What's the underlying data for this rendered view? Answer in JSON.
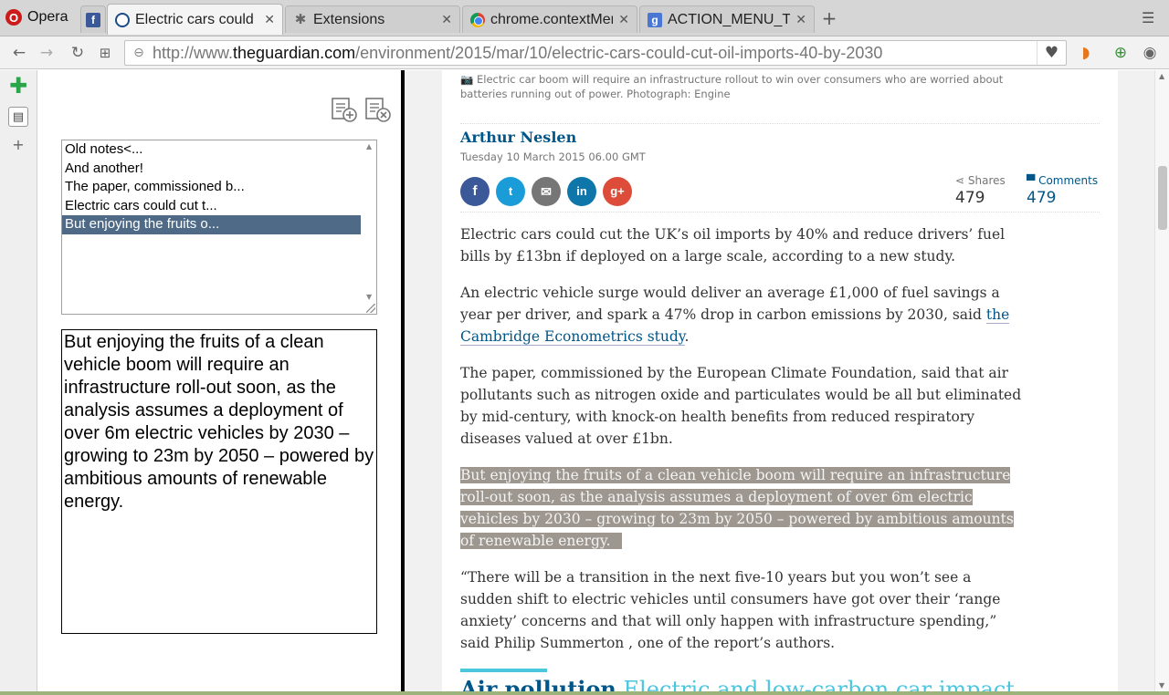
{
  "browser": {
    "opera_label": "Opera",
    "tabs": [
      {
        "title": "",
        "icon": "facebook-icon"
      },
      {
        "title": "Electric cars could c",
        "icon": "guardian-icon",
        "active": true
      },
      {
        "title": "Extensions",
        "icon": "puzzle-icon"
      },
      {
        "title": "chrome.contextMen",
        "icon": "chrome-icon"
      },
      {
        "title": "ACTION_MENU_T",
        "icon": "google-icon"
      }
    ],
    "url_prefix": "http://www.",
    "url_domain": "theguardian.com",
    "url_path": "/environment/2015/mar/10/electric-cars-could-cut-oil-imports-40-by-2030"
  },
  "notes": {
    "items": [
      "Old notes<...",
      "And another!",
      "The paper, commissioned b...",
      "Electric cars could cut t...",
      "But enjoying the fruits o..."
    ],
    "selected_index": 4,
    "editor_text": "But enjoying the fruits of a clean vehicle boom will require an infrastructure roll-out soon, as the analysis assumes a deployment of over 6m electric vehicles by 2030 – growing to 23m by 2050 – powered by ambitious amounts of renewable energy."
  },
  "article": {
    "caption": "Electric car boom will require an infrastructure rollout to win over consumers who are worried about batteries running out of power. Photograph: Engine",
    "author": "Arthur Neslen",
    "date": "Tuesday 10 March 2015 06.00 GMT",
    "shares_label": "Shares",
    "shares_count": "479",
    "comments_label": "Comments",
    "comments_count": "479",
    "p1": "Electric cars could cut the UK’s oil imports by 40% and reduce drivers’ fuel bills by £13bn if deployed on a large scale, according to a new study.",
    "p2_before": "An electric vehicle surge would deliver an average £1,000 of fuel savings a year per driver, and spark a 47% drop in carbon emissions by 2030, said ",
    "p2_link": "the Cambridge Econometrics study",
    "p2_after": ".",
    "p3": "The paper, commissioned by the European Climate Foundation, said that air pollutants such as nitrogen oxide and particulates would be all but eliminated by mid-century, with knock-on health benefits from reduced respiratory diseases valued at over £1bn.",
    "p4": "But enjoying the fruits of a clean vehicle boom will require an infrastructure roll-out soon, as the analysis assumes a deployment of over 6m electric vehicles by 2030 – growing to 23m by 2050 – powered by ambitious amounts of renewable energy.",
    "p5": "“There will be a transition in the next five-10 years but you won’t see a sudden shift to electric vehicles until consumers have got over their ‘range anxiety’ concerns and that will only happen with infrastructure spending,” said Philip Summerton , one of the report’s authors.",
    "section_kicker": "Air pollution",
    "section_title": " Electric and low-carbon car impact"
  },
  "colors": {
    "guardian_blue": "#005689",
    "highlight": "#9d9790",
    "note_selected": "#4f6a87",
    "facebook": "#3b5998",
    "twitter": "#1a9cd8",
    "email": "#767676",
    "linkedin": "#0e76a8",
    "googleplus": "#dd4b39"
  }
}
